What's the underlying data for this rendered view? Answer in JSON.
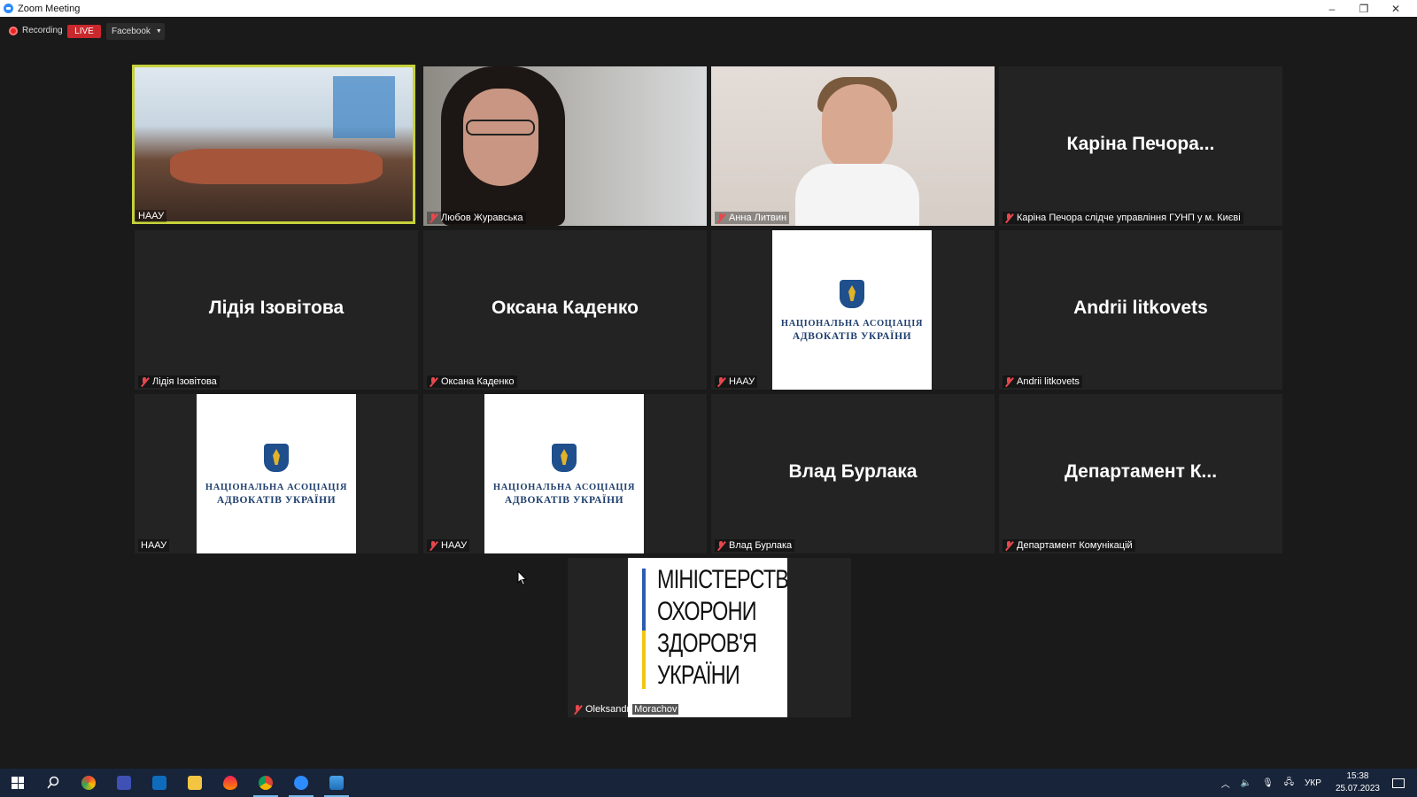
{
  "window": {
    "title": "Zoom Meeting",
    "controls": [
      "–",
      "❐",
      "✕"
    ]
  },
  "toolbar": {
    "recording_label": "Recording",
    "live_badge": "LIVE",
    "stream_target": "Facebook"
  },
  "colors": {
    "active_speaker": "#c6d23a",
    "live": "#c9282d",
    "muted_mic": "#e5484d",
    "taskbar": "#18243a"
  },
  "tiles": [
    {
      "label": "НААУ",
      "muted": false,
      "content": "video",
      "active": true
    },
    {
      "label": "Любов Журавська",
      "muted": true,
      "content": "video"
    },
    {
      "label": "Анна Литвин",
      "muted": true,
      "content": "video"
    },
    {
      "label": "Каріна Печора слідче управління ГУНП у м. Києві",
      "display_name": "Каріна Печора...",
      "muted": true,
      "content": "name"
    },
    {
      "label": "Лідія Ізовітова",
      "display_name": "Лідія Ізовітова",
      "muted": true,
      "content": "name"
    },
    {
      "label": "Оксана Каденко",
      "display_name": "Оксана Каденко",
      "muted": true,
      "content": "name"
    },
    {
      "label": "НААУ",
      "muted": true,
      "content": "logo"
    },
    {
      "label": "Andrii litkovets",
      "display_name": "Andrii litkovets",
      "muted": true,
      "content": "name"
    },
    {
      "label": "НААУ",
      "muted": false,
      "content": "logo"
    },
    {
      "label": "НААУ",
      "muted": true,
      "content": "logo"
    },
    {
      "label": "Влад Бурлака",
      "display_name": "Влад Бурлака",
      "muted": true,
      "content": "name"
    },
    {
      "label": "Департамент Комунікацій",
      "display_name": "Департамент К...",
      "muted": true,
      "content": "name"
    },
    {
      "label_first": "Oleksandr",
      "label_last": "Morachov",
      "muted": true,
      "content": "moz-logo"
    }
  ],
  "naau_logo": {
    "line1": "НАЦІОНАЛЬНА АСОЦІАЦІЯ",
    "line2": "АДВОКАТІВ УКРАЇНИ"
  },
  "moz_logo": {
    "lines": [
      "МІНІСТЕРСТВО",
      "ОХОРОНИ",
      "ЗДОРОВ'Я",
      "УКРАЇНИ"
    ]
  },
  "taskbar": {
    "icons": [
      "windows-start-icon",
      "search-icon",
      "edge-browser-icon",
      "app-icon",
      "outlook-icon",
      "file-explorer-icon",
      "paint-drop-icon",
      "chrome-icon",
      "zoom-icon",
      "photos-icon"
    ],
    "tray": {
      "language": "УКР",
      "time": "15:38",
      "date": "25.07.2023"
    }
  }
}
